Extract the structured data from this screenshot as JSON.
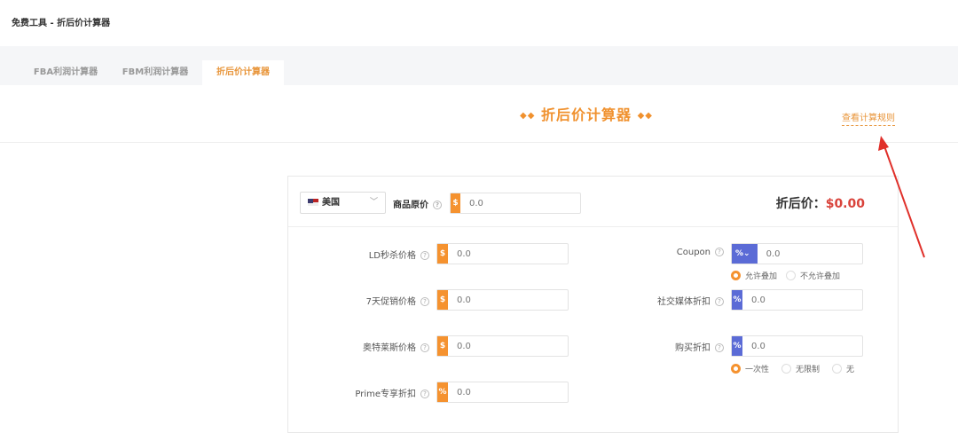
{
  "breadcrumb": "免费工具 - 折后价计算器",
  "tabs": [
    {
      "label": "FBA利润计算器"
    },
    {
      "label": "FBM利润计算器"
    },
    {
      "label": "折后价计算器"
    }
  ],
  "title": "折后价计算器",
  "rules_link": "查看计算规则",
  "country": "美国",
  "original_price": {
    "label": "商品原价",
    "prefix": "$",
    "placeholder": "0.0"
  },
  "result": {
    "label": "折后价：",
    "value": "$0.00"
  },
  "left_fields": [
    {
      "label": "LD秒杀价格",
      "prefix": "$",
      "placeholder": "0.0"
    },
    {
      "label": "7天促销价格",
      "prefix": "$",
      "placeholder": "0.0"
    },
    {
      "label": "奥特莱斯价格",
      "prefix": "$",
      "placeholder": "0.0"
    },
    {
      "label": "Prime专享折扣",
      "prefix": "%",
      "placeholder": "0.0"
    }
  ],
  "right_fields": [
    {
      "label": "Coupon",
      "prefix": "%",
      "placeholder": "0.0",
      "options": [
        "允许叠加",
        "不允许叠加"
      ],
      "selected": 0
    },
    {
      "label": "社交媒体折扣",
      "prefix": "%",
      "placeholder": "0.0"
    },
    {
      "label": "购买折扣",
      "prefix": "%",
      "placeholder": "0.0",
      "options": [
        "一次性",
        "无限制",
        "无"
      ],
      "selected": 0
    }
  ],
  "colors": {
    "accent": "#f5922f",
    "blue": "#5b6bd6",
    "price": "#d9433b"
  }
}
